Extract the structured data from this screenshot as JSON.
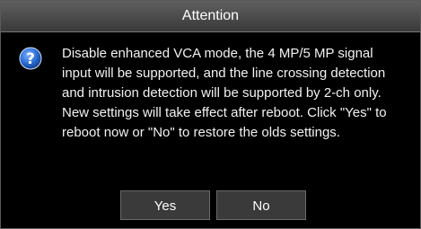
{
  "dialog": {
    "title": "Attention",
    "icon": "question-icon",
    "message": "Disable enhanced VCA mode, the 4 MP/5 MP signal input will be supported, and the line crossing detection and intrusion detection will be supported by 2-ch only. New settings will take effect after reboot. Click \"Yes\" to reboot now or \"No\" to restore the olds settings.",
    "buttons": {
      "yes_label": "Yes",
      "no_label": "No"
    },
    "colors": {
      "titlebar": "#4a4a4a",
      "background": "#000000",
      "text": "#ffffff",
      "icon_blue": "#2c6fd6"
    }
  }
}
